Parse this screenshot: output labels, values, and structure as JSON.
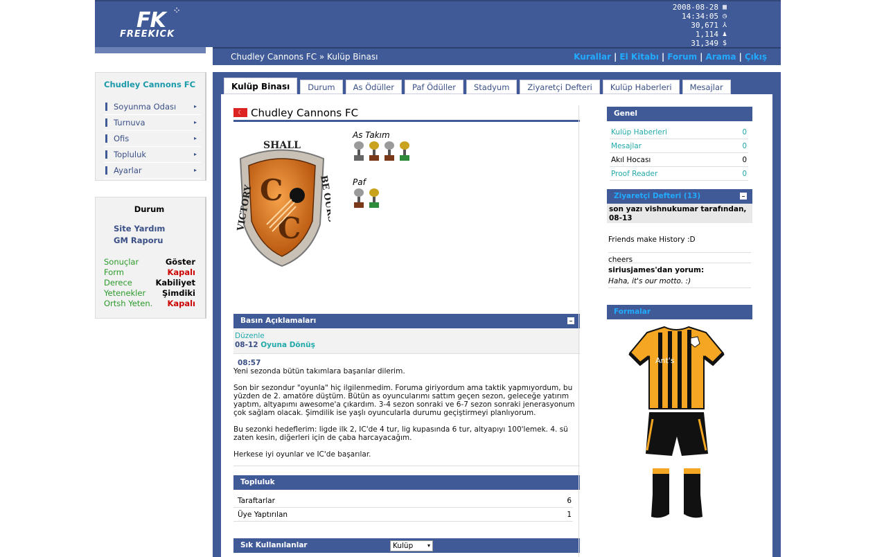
{
  "header": {
    "logo": {
      "fk": "FK",
      "name": "FREEKICK"
    },
    "stats": [
      {
        "value": "2008-08-28",
        "icon": "calendar-icon",
        "glyph": "▦"
      },
      {
        "value": "14:34:05",
        "icon": "clock-icon",
        "glyph": "◷"
      },
      {
        "value": "30,671",
        "icon": "users-icon",
        "glyph": "⅄"
      },
      {
        "value": "1,114",
        "icon": "user-icon",
        "glyph": "♟"
      },
      {
        "value": "31,349",
        "icon": "money-icon",
        "glyph": "$"
      }
    ]
  },
  "breadcrumb": "Chudley Cannons FC » Kulüp Binası",
  "toplinks": [
    "Kurallar",
    "El Kitabı",
    "Forum",
    "Arama",
    "Çıkış"
  ],
  "menu": {
    "club": "Chudley Cannons FC",
    "items": [
      "Soyunma Odası",
      "Turnuva",
      "Ofis",
      "Topluluk",
      "Ayarlar"
    ]
  },
  "durum": {
    "title": "Durum",
    "links": [
      "Site Yardım",
      "GM Raporu"
    ],
    "stats": [
      {
        "k": "Sonuçlar",
        "v": "Göster",
        "red": false
      },
      {
        "k": "Form",
        "v": "Kapalı",
        "red": true
      },
      {
        "k": "Derece",
        "v": "Kabiliyet",
        "red": false
      },
      {
        "k": "Yetenekler",
        "v": "Şimdiki",
        "red": false
      },
      {
        "k": "Ortsh Yeten.",
        "v": "Kapalı",
        "red": true
      }
    ]
  },
  "tabs": [
    "Kulüp Binası",
    "Durum",
    "As Ödüller",
    "Paf Ödüller",
    "Stadyum",
    "Ziyaretçi Defteri",
    "Kulüp Haberleri",
    "Mesajlar"
  ],
  "club": {
    "name": "Chudley Cannons FC",
    "flag": "☾",
    "crest": {
      "top": "SHALL",
      "left": "VICTORY",
      "right": "BE OURS"
    },
    "as_label": "As Takım",
    "paf_label": "Paf"
  },
  "press": {
    "title": "Basın Açıklamaları",
    "edit": "Düzenle",
    "date": "08-12",
    "headline": "Oyuna Dönüş",
    "time": "08:57",
    "paragraphs": [
      "Yeni sezonda bütün takımlara başarılar dilerim.",
      "Son bir sezondur \"oyunla\" hiç ilgilenmedim. Foruma giriyordum ama taktik yapmıyordum, bu yüzden de 2. amatöre düştüm. Bütün as oyuncularımı sattım geçen sezon, geleceğe yatırım yaptım, altyapımı awesome'a çıkardım. 3-4 sezon sonraki ve 6-7 sezon sonraki jenerasyonum çok sağlam olacak. Şimdilik ise yaşlı oyuncularla durumu geçiştirmeyi planlıyorum.",
      "Bu sezonki hedeflerim: ligde ilk 2, IC'de 4 tur, lig kupasında 6 tur, altyapıyı 100'lemek. 4. sü zaten kesin, diğerleri için de çaba harcayacağım.",
      "Herkese iyi oyunlar ve IC'de başarılar."
    ]
  },
  "community": {
    "title": "Topluluk",
    "rows": [
      {
        "k": "Taraftarlar",
        "v": "6"
      },
      {
        "k": "Üye Yaptırılan",
        "v": "1"
      }
    ]
  },
  "frequent": {
    "title": "Sık Kullanılanlar",
    "select": "Kulüp"
  },
  "general": {
    "title": "Genel",
    "rows": [
      {
        "k": "Kulüp Haberleri",
        "v": "0",
        "link": true
      },
      {
        "k": "Mesajlar",
        "v": "0",
        "link": true
      },
      {
        "k": "Akıl Hocası",
        "v": "0",
        "link": false
      },
      {
        "k": "Proof Reader",
        "v": "0",
        "link": true
      }
    ]
  },
  "guestbook": {
    "title": "Ziyaretçi Defteri (13)",
    "head": "son yazı vishnukumar tarafından, 08-13",
    "msg1": "Friends make History :D",
    "msg2": "cheers",
    "comment_by": "siriusjames'dan yorum:",
    "comment": "Haha, it's our motto. :)"
  },
  "kits": {
    "title": "Formalar",
    "shirt_text": "Ant's"
  },
  "colors": {
    "primary": "#3f5a97",
    "accent": "#22aaff",
    "kit_orange": "#f5a623",
    "kit_black": "#111111"
  }
}
